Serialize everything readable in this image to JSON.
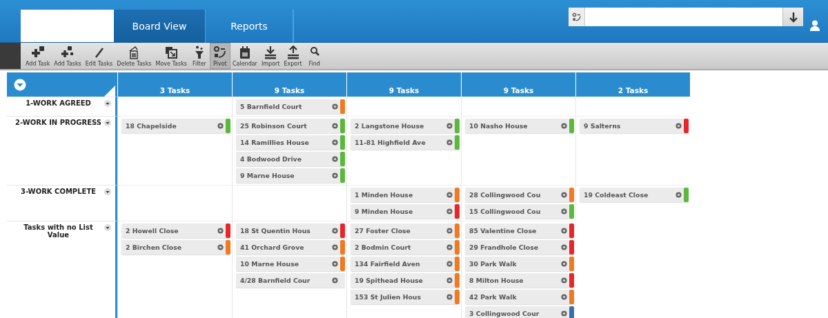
{
  "tabs": [
    {
      "label": "Board View",
      "selected": true
    },
    {
      "label": "Reports",
      "selected": false
    }
  ],
  "toolbar": [
    {
      "label": "Add Task",
      "kind": "add",
      "selected": false
    },
    {
      "label": "Add Tasks",
      "kind": "add-multi",
      "selected": false
    },
    {
      "label": "Edit Tasks",
      "kind": "edit",
      "selected": false
    },
    {
      "label": "Delete Tasks",
      "kind": "delete",
      "selected": false
    },
    {
      "label": "Move Tasks",
      "kind": "move",
      "selected": false
    },
    {
      "label": "Filter",
      "kind": "filter",
      "selected": false
    },
    {
      "label": "Pivot",
      "kind": "pivot",
      "selected": true
    },
    {
      "label": "Calendar",
      "kind": "calendar",
      "selected": false
    },
    {
      "label": "Import",
      "kind": "import",
      "selected": false
    },
    {
      "label": "Export",
      "kind": "export",
      "selected": false
    },
    {
      "label": "Find",
      "kind": "find",
      "selected": false
    }
  ],
  "columns": [
    {
      "count": "3 Tasks"
    },
    {
      "count": "9 Tasks"
    },
    {
      "count": "9 Tasks"
    },
    {
      "count": "9 Tasks"
    },
    {
      "count": "2 Tasks"
    }
  ],
  "lanes": [
    {
      "label": "1-WORK AGREED",
      "cells": [
        [],
        [
          {
            "text": "5 Barnfield Court",
            "color": "#f07a22"
          }
        ],
        [],
        [],
        []
      ]
    },
    {
      "label": "2-WORK IN PROGRESS",
      "cells": [
        [
          {
            "text": "18 Chapelside",
            "color": "#5cb83a"
          }
        ],
        [
          {
            "text": "25 Robinson Court",
            "color": "#5cb83a"
          },
          {
            "text": "14 Ramillies House",
            "color": "#5cb83a"
          },
          {
            "text": "4 Bodwood Drive",
            "color": "#5cb83a"
          },
          {
            "text": "9 Marne House",
            "color": "#5cb83a"
          }
        ],
        [
          {
            "text": "2 Langstone House",
            "color": "#5cb83a"
          },
          {
            "text": "11-81 Highfield Ave",
            "color": "#5cb83a"
          }
        ],
        [
          {
            "text": "10 Nasho House",
            "color": "#5cb83a"
          }
        ],
        [
          {
            "text": "9 Salterns",
            "color": "#e8262a"
          }
        ]
      ]
    },
    {
      "label": "3-WORK COMPLETE",
      "cells": [
        [],
        [],
        [
          {
            "text": "1 Minden House",
            "color": "#f07a22"
          },
          {
            "text": "9 Minden House",
            "color": "#e8262a"
          }
        ],
        [
          {
            "text": "28 Collingwood Cou",
            "color": "#f07a22"
          },
          {
            "text": "15 Collingwood Cou",
            "color": "#5cb83a"
          }
        ],
        [
          {
            "text": "19 Coldeast Close",
            "color": "#5cb83a"
          }
        ]
      ]
    },
    {
      "label": "Tasks with no List Value",
      "cells": [
        [
          {
            "text": "2 Howell Close",
            "color": "#e8262a"
          },
          {
            "text": "2 Birchen Close",
            "color": "#f07a22"
          }
        ],
        [
          {
            "text": "18 St Quentin Hous",
            "color": "#e8262a"
          },
          {
            "text": "41 Orchard Grove",
            "color": "#f07a22"
          },
          {
            "text": "10 Marne House",
            "color": "#f07a22"
          },
          {
            "text": "4/28 Barnfield Cour"
          }
        ],
        [
          {
            "text": "27 Foster Close",
            "color": "#f07a22"
          },
          {
            "text": "2 Bodmin Court",
            "color": "#f07a22"
          },
          {
            "text": "134 Fairfield Aven",
            "color": "#f07a22"
          },
          {
            "text": "19 Spithead House",
            "color": "#f07a22"
          },
          {
            "text": "153 St Julien Hous",
            "color": "#f07a22"
          }
        ],
        [
          {
            "text": "85 Valentine Close",
            "color": "#e8262a"
          },
          {
            "text": "29 Frandhole Close",
            "color": "#e8262a"
          },
          {
            "text": "30 Park Walk",
            "color": "#f07a22"
          },
          {
            "text": "8 Milton House",
            "color": "#e8262a"
          },
          {
            "text": "42 Park Walk",
            "color": "#f07a22"
          },
          {
            "text": "3 Collingwood Cour",
            "color": "#3a6ea8"
          }
        ]
      ]
    }
  ]
}
